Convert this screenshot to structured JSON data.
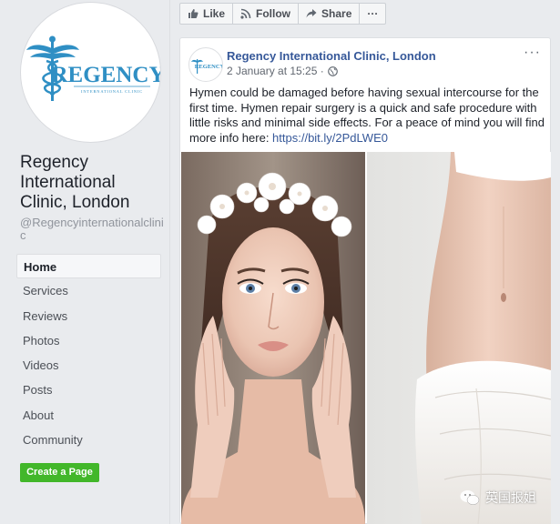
{
  "page": {
    "name": "Regency International Clinic, London",
    "handle": "@Regencyinternationalclinic",
    "logo_text": "REGENCY",
    "logo_subtext": "INTERNATIONAL CLINIC",
    "brand_color": "#2f8fc4"
  },
  "nav": {
    "items": [
      "Home",
      "Services",
      "Reviews",
      "Photos",
      "Videos",
      "Posts",
      "About",
      "Community"
    ],
    "active": "Home"
  },
  "create_page_label": "Create a Page",
  "actions": {
    "like": "Like",
    "follow": "Follow",
    "share": "Share",
    "more": "···"
  },
  "post": {
    "author": "Regency International Clinic, London",
    "timestamp": "2 January at 15:25 ·",
    "more": "···",
    "text": "Hymen could be damaged before having sexual intercourse for the first time. Hymen repair surgery is a quick and safe procedure with little risks and minimal side effects. For a peace of mind you will find more info here: ",
    "link": "https://bit.ly/2PdLWE0"
  },
  "watermark": "英国报姐",
  "colors": {
    "link": "#365899",
    "create_button": "#42b72a",
    "background": "#e9ebee"
  }
}
